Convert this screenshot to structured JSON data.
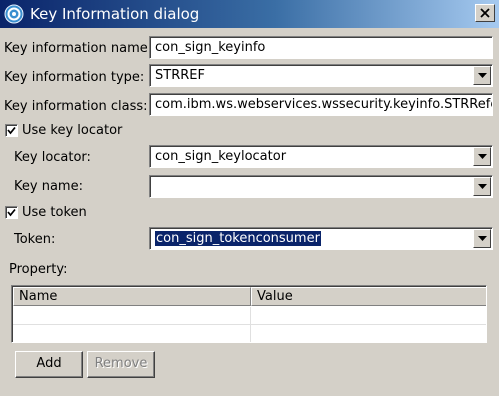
{
  "window": {
    "title": "Key Information dialog"
  },
  "fields": {
    "key_info_name": {
      "label": "Key information name:",
      "value": "con_sign_keyinfo"
    },
    "key_info_type": {
      "label": "Key information type:",
      "value": "STRREF"
    },
    "key_info_class": {
      "label": "Key information class:",
      "value": "com.ibm.ws.webservices.wssecurity.keyinfo.STRReferen"
    },
    "use_key_locator": {
      "label": "Use key locator",
      "checked": true
    },
    "key_locator": {
      "label": "Key locator:",
      "value": "con_sign_keylocator"
    },
    "key_name": {
      "label": "Key name:",
      "value": ""
    },
    "use_token": {
      "label": "Use token",
      "checked": true
    },
    "token": {
      "label": "Token:",
      "value": "con_sign_tokenconsumer"
    }
  },
  "property": {
    "label": "Property:",
    "columns": [
      "Name",
      "Value"
    ],
    "rows": []
  },
  "buttons": {
    "add": "Add",
    "remove": "Remove"
  },
  "colors": {
    "titlebar_start": "#0a246a",
    "titlebar_end": "#a6caf0",
    "face": "#d4d0c8",
    "selection": "#0a246a"
  },
  "icons": {
    "app": "eclipse-app-icon",
    "close": "close-icon",
    "dropdown": "chevron-down-icon",
    "check": "checkmark-icon"
  }
}
